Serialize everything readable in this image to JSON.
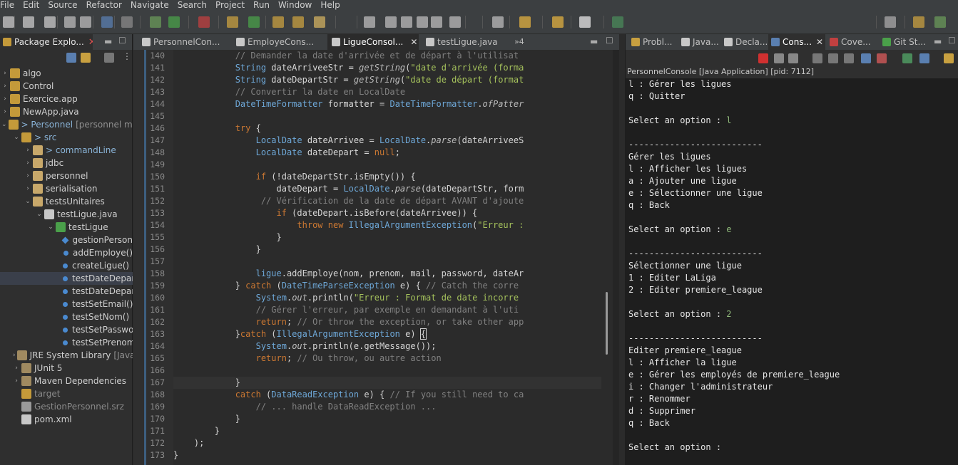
{
  "menu": [
    "File",
    "Edit",
    "Source",
    "Refactor",
    "Navigate",
    "Search",
    "Project",
    "Run",
    "Window",
    "Help"
  ],
  "package_explorer": {
    "tab_label": "Package Explo...",
    "tree": [
      {
        "label": "algo",
        "depth": 0,
        "twisty": "›",
        "icon": "project-icon"
      },
      {
        "label": "Control",
        "depth": 0,
        "twisty": "›",
        "icon": "project-icon"
      },
      {
        "label": "Exercice.app",
        "depth": 0,
        "twisty": "›",
        "icon": "project-icon"
      },
      {
        "label": "NewApp.java",
        "depth": 0,
        "twisty": "›",
        "icon": "project-icon"
      },
      {
        "label": "> Personnel",
        "extra": "[personnel maste",
        "depth": 0,
        "twisty": "⌄",
        "icon": "project-icon",
        "style": "git"
      },
      {
        "label": "> src",
        "depth": 1,
        "twisty": "⌄",
        "icon": "source-folder-icon",
        "style": "git"
      },
      {
        "label": "> commandLine",
        "depth": 2,
        "twisty": "›",
        "icon": "package-icon",
        "style": "git"
      },
      {
        "label": "jdbc",
        "depth": 2,
        "twisty": "›",
        "icon": "package-icon"
      },
      {
        "label": "personnel",
        "depth": 2,
        "twisty": "›",
        "icon": "package-icon"
      },
      {
        "label": "serialisation",
        "depth": 2,
        "twisty": "›",
        "icon": "package-icon"
      },
      {
        "label": "testsUnitaires",
        "depth": 2,
        "twisty": "⌄",
        "icon": "package-icon"
      },
      {
        "label": "testLigue.java",
        "depth": 3,
        "twisty": "⌄",
        "icon": "java-file-icon"
      },
      {
        "label": "testLigue",
        "depth": 4,
        "twisty": "⌄",
        "icon": "class-icon"
      },
      {
        "label": "gestionPerson",
        "depth": 5,
        "twisty": "",
        "icon": "field-icon"
      },
      {
        "label": "addEmploye()",
        "depth": 5,
        "twisty": "",
        "icon": "method-icon"
      },
      {
        "label": "createLigue() :",
        "depth": 5,
        "twisty": "",
        "icon": "method-icon"
      },
      {
        "label": "testDateDepar",
        "depth": 5,
        "twisty": "",
        "icon": "method-icon",
        "selected": true
      },
      {
        "label": "testDateDepar",
        "depth": 5,
        "twisty": "",
        "icon": "method-icon"
      },
      {
        "label": "testSetEmail()",
        "depth": 5,
        "twisty": "",
        "icon": "method-icon"
      },
      {
        "label": "testSetNom() :",
        "depth": 5,
        "twisty": "",
        "icon": "method-icon"
      },
      {
        "label": "testSetPasswo",
        "depth": 5,
        "twisty": "",
        "icon": "method-icon"
      },
      {
        "label": "testSetPrenom",
        "depth": 5,
        "twisty": "",
        "icon": "method-icon"
      },
      {
        "label": "JRE System Library",
        "extra": "[JavaSE",
        "depth": 1,
        "twisty": "›",
        "icon": "library-icon"
      },
      {
        "label": "JUnit 5",
        "depth": 1,
        "twisty": "›",
        "icon": "library-icon"
      },
      {
        "label": "Maven Dependencies",
        "depth": 1,
        "twisty": "›",
        "icon": "library-icon"
      },
      {
        "label": "target",
        "depth": 1,
        "twisty": "",
        "icon": "folder-icon",
        "style": "dim"
      },
      {
        "label": "GestionPersonnel.srz",
        "depth": 1,
        "twisty": "",
        "icon": "file-icon",
        "style": "dim"
      },
      {
        "label": "pom.xml",
        "depth": 1,
        "twisty": "",
        "icon": "xml-file-icon"
      }
    ]
  },
  "editor": {
    "tabs": [
      "PersonnelCon...",
      "EmployeCons...",
      "LigueConsol...",
      "testLigue.java"
    ],
    "active_tab": 2,
    "overflow_count": "»4",
    "lines": [
      {
        "n": "140",
        "tokens": [
          [
            "cm",
            "            // Demander la date d'arrivée et de départ à l'utilisat"
          ]
        ]
      },
      {
        "n": "141",
        "tokens": [
          [
            "ty",
            "            String "
          ],
          [
            "v",
            "dateArriveeStr"
          ],
          [
            "",
            " = "
          ],
          [
            "mi",
            "getString"
          ],
          [
            "",
            "("
          ],
          [
            "st",
            "\"date d'arrivée (forma"
          ]
        ]
      },
      {
        "n": "142",
        "tokens": [
          [
            "ty",
            "            String "
          ],
          [
            "v",
            "dateDepartStr"
          ],
          [
            "",
            " = "
          ],
          [
            "mi",
            "getString"
          ],
          [
            "",
            "("
          ],
          [
            "st",
            "\"date de départ (format"
          ]
        ]
      },
      {
        "n": "143",
        "tokens": [
          [
            "cm",
            "            // Convertir la date en LocalDate"
          ]
        ]
      },
      {
        "n": "144",
        "tokens": [
          [
            "ty",
            "            DateTimeFormatter "
          ],
          [
            "v",
            "formatter"
          ],
          [
            "",
            " = "
          ],
          [
            "ty",
            "DateTimeFormatter"
          ],
          [
            "",
            "."
          ],
          [
            "mi",
            "ofPatter"
          ]
        ]
      },
      {
        "n": "145",
        "tokens": [
          [
            "",
            ""
          ]
        ]
      },
      {
        "n": "146",
        "tokens": [
          [
            "k",
            "            try"
          ],
          [
            "",
            " {"
          ]
        ]
      },
      {
        "n": "147",
        "tokens": [
          [
            "ty",
            "                LocalDate "
          ],
          [
            "v",
            "dateArrivee"
          ],
          [
            "",
            " = "
          ],
          [
            "ty",
            "LocalDate"
          ],
          [
            "",
            "."
          ],
          [
            "mi",
            "parse"
          ],
          [
            "",
            "(dateArriveeS"
          ]
        ]
      },
      {
        "n": "148",
        "tokens": [
          [
            "ty",
            "                LocalDate "
          ],
          [
            "v",
            "dateDepart"
          ],
          [
            "",
            " = "
          ],
          [
            "k",
            "null"
          ],
          [
            "",
            ";"
          ]
        ]
      },
      {
        "n": "149",
        "tokens": [
          [
            "",
            ""
          ]
        ]
      },
      {
        "n": "150",
        "tokens": [
          [
            "k",
            "                if"
          ],
          [
            "",
            " (!dateDepartStr.isEmpty()) {"
          ]
        ]
      },
      {
        "n": "151",
        "tokens": [
          [
            "v",
            "                    dateDepart"
          ],
          [
            "",
            " = "
          ],
          [
            "ty",
            "LocalDate"
          ],
          [
            "",
            "."
          ],
          [
            "mi",
            "parse"
          ],
          [
            "",
            "(dateDepartStr, form"
          ]
        ]
      },
      {
        "n": "152",
        "tokens": [
          [
            "cm",
            "                 // Vérification de la date de départ AVANT d'ajoute"
          ]
        ]
      },
      {
        "n": "153",
        "tokens": [
          [
            "k",
            "                    if"
          ],
          [
            "",
            " (dateDepart.isBefore(dateArrivee)) {"
          ]
        ]
      },
      {
        "n": "154",
        "tokens": [
          [
            "k",
            "                        throw new "
          ],
          [
            "ty",
            "IllegalArgumentException"
          ],
          [
            "",
            "("
          ],
          [
            "st",
            "\"Erreur :"
          ]
        ]
      },
      {
        "n": "155",
        "tokens": [
          [
            "",
            "                    }"
          ]
        ]
      },
      {
        "n": "156",
        "tokens": [
          [
            "",
            "                }"
          ]
        ]
      },
      {
        "n": "157",
        "tokens": [
          [
            "",
            ""
          ]
        ]
      },
      {
        "n": "158",
        "tokens": [
          [
            "ty",
            "                ligue"
          ],
          [
            "",
            ".addEmploye(nom, prenom, mail, password, dateAr"
          ]
        ]
      },
      {
        "n": "159",
        "tokens": [
          [
            "",
            "            } "
          ],
          [
            "k",
            "catch"
          ],
          [
            "",
            " ("
          ],
          [
            "ty",
            "DateTimeParseException"
          ],
          [
            "",
            " e) { "
          ],
          [
            "cm",
            "// Catch the corre"
          ]
        ]
      },
      {
        "n": "160",
        "tokens": [
          [
            "ty",
            "                System"
          ],
          [
            "",
            "."
          ],
          [
            "fo",
            "out"
          ],
          [
            "",
            ".println("
          ],
          [
            "st",
            "\"Erreur : Format de date incorre"
          ]
        ]
      },
      {
        "n": "161",
        "tokens": [
          [
            "cm",
            "                // Gérer l'erreur, par exemple en demandant à l'uti"
          ]
        ]
      },
      {
        "n": "162",
        "tokens": [
          [
            "k",
            "                return"
          ],
          [
            "",
            "; "
          ],
          [
            "cm",
            "// Or throw the exception, or take other app"
          ]
        ]
      },
      {
        "n": "163",
        "tokens": [
          [
            "",
            "            }"
          ],
          [
            "k",
            "catch"
          ],
          [
            "",
            " ("
          ],
          [
            "ty",
            "IllegalArgumentException"
          ],
          [
            "",
            " e) "
          ],
          [
            "sel",
            "{"
          ]
        ]
      },
      {
        "n": "164",
        "tokens": [
          [
            "ty",
            "                System"
          ],
          [
            "",
            "."
          ],
          [
            "fo",
            "out"
          ],
          [
            "",
            ".println(e.getMessage());"
          ]
        ]
      },
      {
        "n": "165",
        "tokens": [
          [
            "k",
            "                return"
          ],
          [
            "",
            "; "
          ],
          [
            "cm",
            "// Ou throw, ou autre action"
          ]
        ]
      },
      {
        "n": "166",
        "tokens": [
          [
            "",
            ""
          ]
        ]
      },
      {
        "n": "167",
        "tokens": [
          [
            "",
            "            }"
          ]
        ],
        "current": true
      },
      {
        "n": "168",
        "tokens": [
          [
            "k",
            "            catch"
          ],
          [
            "",
            " ("
          ],
          [
            "ty",
            "DataReadException"
          ],
          [
            "",
            " e) { "
          ],
          [
            "cm",
            "// If you still need to ca"
          ]
        ]
      },
      {
        "n": "169",
        "tokens": [
          [
            "cm",
            "                // ... handle DataReadException ..."
          ]
        ]
      },
      {
        "n": "170",
        "tokens": [
          [
            "",
            "            }"
          ]
        ]
      },
      {
        "n": "171",
        "tokens": [
          [
            "",
            "        }"
          ]
        ]
      },
      {
        "n": "172",
        "tokens": [
          [
            "",
            "    );"
          ]
        ]
      },
      {
        "n": "173",
        "tokens": [
          [
            "",
            "}"
          ]
        ]
      }
    ]
  },
  "console": {
    "tabs": [
      "Probl...",
      "Java...",
      "Decla...",
      "Cons...",
      "Cove...",
      "Git St..."
    ],
    "active_tab": 3,
    "title": "PersonnelConsole [Java Application]  [pid: 7112]",
    "lines": [
      {
        "text": "l : Gérer les ligues"
      },
      {
        "text": "q : Quitter"
      },
      {
        "text": ""
      },
      {
        "text": "Select an option : ",
        "input": "l"
      },
      {
        "text": ""
      },
      {
        "text": "--------------------------"
      },
      {
        "text": "Gérer les ligues"
      },
      {
        "text": "l : Afficher les ligues"
      },
      {
        "text": "a : Ajouter une ligue"
      },
      {
        "text": "e : Sélectionner une ligue"
      },
      {
        "text": "q : Back"
      },
      {
        "text": ""
      },
      {
        "text": "Select an option : ",
        "input": "e"
      },
      {
        "text": ""
      },
      {
        "text": "--------------------------"
      },
      {
        "text": "Sélectionner une ligue"
      },
      {
        "text": "1 : Editer LaLiga"
      },
      {
        "text": "2 : Editer premiere_league"
      },
      {
        "text": ""
      },
      {
        "text": "Select an option : ",
        "input": "2"
      },
      {
        "text": ""
      },
      {
        "text": "--------------------------"
      },
      {
        "text": "Editer premiere_league"
      },
      {
        "text": "l : Afficher la ligue"
      },
      {
        "text": "e : Gérer les employés de premiere_league"
      },
      {
        "text": "i : Changer l'administrateur"
      },
      {
        "text": "r : Renommer"
      },
      {
        "text": "d : Supprimer"
      },
      {
        "text": "q : Back"
      },
      {
        "text": ""
      },
      {
        "text": "Select an option : "
      }
    ]
  },
  "colors": {
    "background": "#2b2b2b",
    "keyword": "#cc7832",
    "type": "#6ea8d8",
    "string": "#a5c25c",
    "comment": "#808080",
    "console_input": "#8fb87a",
    "close_red": "#e05050"
  }
}
